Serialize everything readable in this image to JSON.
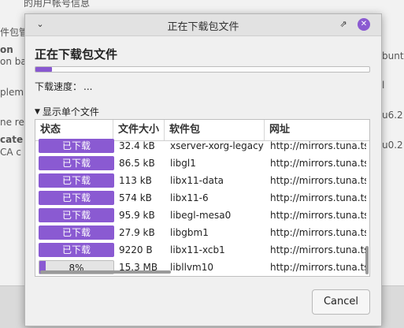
{
  "background": {
    "fragments": [
      {
        "text": "的用户帐号信息"
      },
      {
        "text": "件包管"
      },
      {
        "text": "on"
      },
      {
        "text": "on ba"
      },
      {
        "text": "plem"
      },
      {
        "text": "ne re"
      },
      {
        "text": "cate"
      },
      {
        "text": "CA c"
      },
      {
        "text": "bunt"
      },
      {
        "text": "l"
      },
      {
        "text": "u6.2"
      },
      {
        "text": "u0.2"
      }
    ]
  },
  "dialog": {
    "title": "正在下载包文件",
    "heading": "正在下载包文件",
    "progress_fraction": 0.05,
    "speed_label": "下载速度：",
    "speed_value": "...",
    "expander_label": "显示单个文件",
    "columns": [
      "状态",
      "文件大小",
      "软件包",
      "网址"
    ],
    "rows": [
      {
        "status": "已下载",
        "size": "32.4 kB",
        "package": "xserver-xorg-legacy",
        "url": "http://mirrors.tuna.ts",
        "progress": 1
      },
      {
        "status": "已下载",
        "size": "86.5 kB",
        "package": "libgl1",
        "url": "http://mirrors.tuna.ts",
        "progress": 1
      },
      {
        "status": "已下载",
        "size": "113 kB",
        "package": "libx11-data",
        "url": "http://mirrors.tuna.ts",
        "progress": 1
      },
      {
        "status": "已下载",
        "size": "574 kB",
        "package": "libx11-6",
        "url": "http://mirrors.tuna.ts",
        "progress": 1
      },
      {
        "status": "已下载",
        "size": "95.9 kB",
        "package": "libegl-mesa0",
        "url": "http://mirrors.tuna.ts",
        "progress": 1
      },
      {
        "status": "已下载",
        "size": "27.9 kB",
        "package": "libgbm1",
        "url": "http://mirrors.tuna.ts",
        "progress": 1
      },
      {
        "status": "已下载",
        "size": "9220  B",
        "package": "libx11-xcb1",
        "url": "http://mirrors.tuna.ts",
        "progress": 1
      },
      {
        "status": "8%",
        "size": "15.3 MB",
        "package": "libllvm10",
        "url": "http://mirrors.tuna.ts",
        "progress": 0.08
      }
    ],
    "cancel_label": "Cancel"
  },
  "colors": {
    "accent": "#8a5ad2",
    "close_button": "#8b5ad1"
  },
  "icons": {
    "minimize": "chevron-down-icon",
    "restore": "restore-icon",
    "close": "close-icon",
    "expander": "triangle-down-icon"
  }
}
